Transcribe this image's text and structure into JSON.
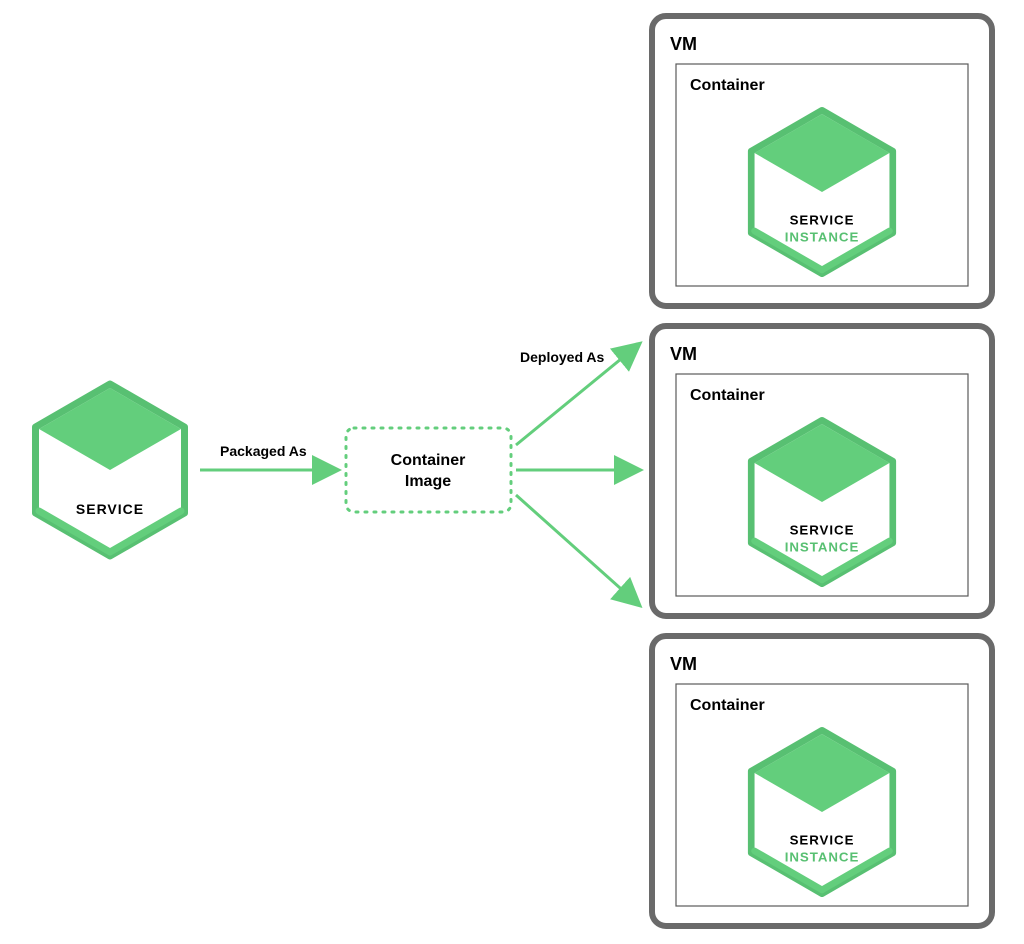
{
  "service": {
    "label": "SERVICE"
  },
  "arrows": {
    "packaged": "Packaged As",
    "deployed": "Deployed As"
  },
  "containerImage": {
    "line1": "Container",
    "line2": "Image"
  },
  "vm": {
    "title": "VM",
    "container": {
      "title": "Container",
      "hex": {
        "line1": "SERVICE",
        "line2": "INSTANCE"
      }
    }
  },
  "colors": {
    "green": "#63ce7c",
    "greenDark": "#55b86c",
    "greenMid": "#58c072",
    "boxBorder": "#6a6a6a",
    "innerBorder": "#5a5a5a"
  }
}
